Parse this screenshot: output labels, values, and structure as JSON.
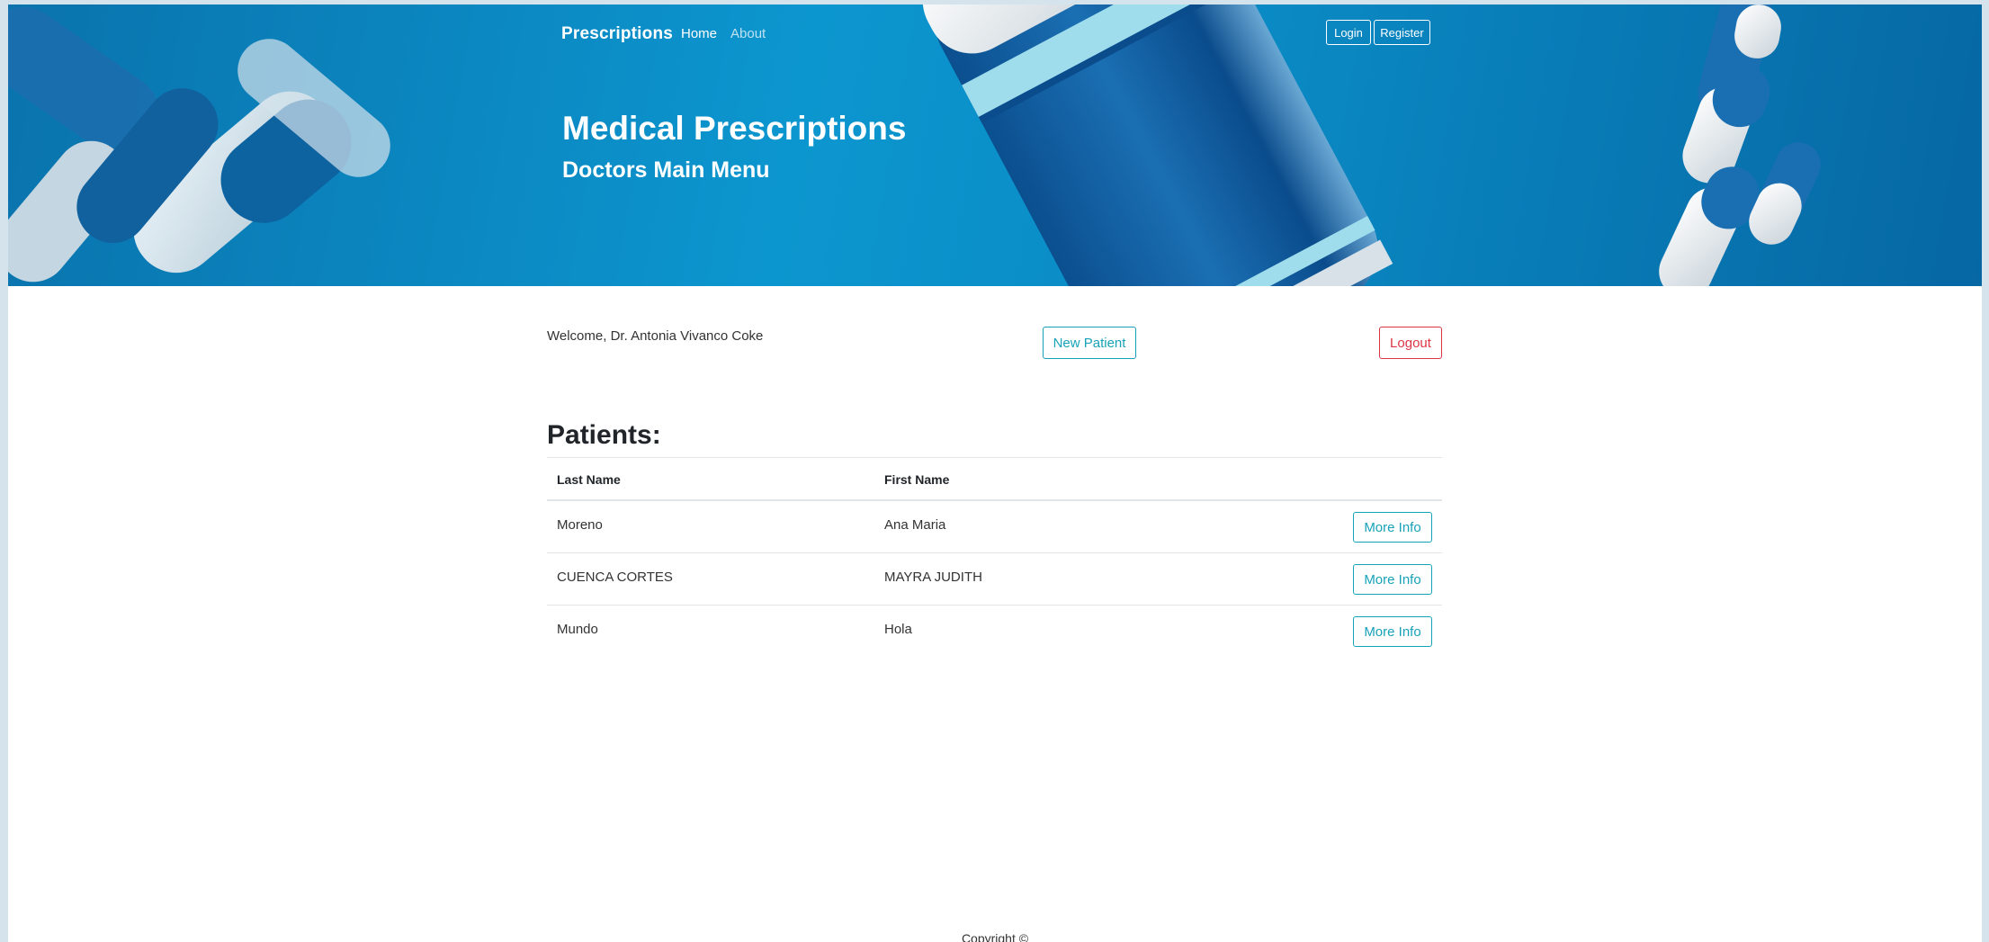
{
  "colors": {
    "hero_blue": "#0c96cf",
    "accent_info": "#17a2b8",
    "danger": "#dc3545"
  },
  "nav": {
    "brand": "Prescriptions",
    "links": [
      {
        "label": "Home"
      },
      {
        "label": "About"
      }
    ],
    "login_label": "Login",
    "register_label": "Register"
  },
  "hero": {
    "title": "Medical Prescriptions",
    "subtitle": "Doctors Main Menu"
  },
  "main": {
    "welcome_text": "Welcome, Dr. Antonia Vivanco Coke",
    "new_patient_label": "New Patient",
    "logout_label": "Logout",
    "section_title": "Patients:",
    "table": {
      "columns": [
        "Last Name",
        "First Name"
      ],
      "rows": [
        {
          "last_name": "Moreno",
          "first_name": "Ana Maria",
          "action": "More Info"
        },
        {
          "last_name": "CUENCA CORTES",
          "first_name": "MAYRA JUDITH",
          "action": "More Info"
        },
        {
          "last_name": "Mundo",
          "first_name": "Hola",
          "action": "More Info"
        }
      ]
    }
  },
  "footer": {
    "copyright": "Copyright ©"
  }
}
